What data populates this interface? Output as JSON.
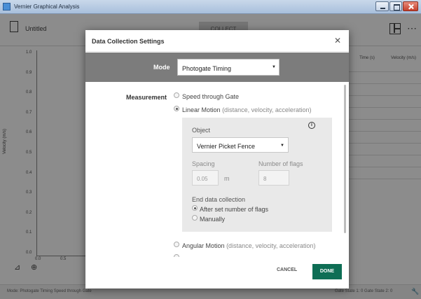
{
  "window": {
    "title": "Vernier Graphical Analysis"
  },
  "header": {
    "doc_title": "Untitled",
    "collect_label": "COLLECT"
  },
  "graph": {
    "y_axis_label": "Velocity (m/s)",
    "y_ticks": [
      "1.0",
      "0.9",
      "0.8",
      "0.7",
      "0.6",
      "0.5",
      "0.4",
      "0.3",
      "0.2",
      "0.1",
      "0.0"
    ],
    "x_ticks": [
      "0.0",
      "0.5"
    ]
  },
  "table": {
    "columns": [
      {
        "label": "Time (s)"
      },
      {
        "label": "Velocity (m/s)"
      }
    ]
  },
  "status": {
    "left": "Mode: Photogate Timing   Speed through Gate",
    "right": "Gate State 1: 0     Gate State 2: 0"
  },
  "dialog": {
    "title": "Data Collection Settings",
    "mode_label": "Mode",
    "mode_value": "Photogate Timing",
    "measurement_label": "Measurement",
    "options": [
      {
        "label": "Speed through Gate",
        "sub": "",
        "selected": false
      },
      {
        "label": "Linear Motion",
        "sub": "(distance, velocity, acceleration)",
        "selected": true
      },
      {
        "label": "Angular Motion",
        "sub": "(distance, velocity, acceleration)",
        "selected": false
      }
    ],
    "object_panel": {
      "object_label": "Object",
      "object_value": "Vernier Picket Fence",
      "spacing_label": "Spacing",
      "spacing_value": "0.05",
      "spacing_unit": "m",
      "flags_label": "Number of flags",
      "flags_value": "8",
      "end_label": "End data collection",
      "end_options": [
        {
          "label": "After set number of flags",
          "selected": true
        },
        {
          "label": "Manually",
          "selected": false
        }
      ]
    },
    "cancel_label": "CANCEL",
    "done_label": "DONE"
  },
  "colors": {
    "accent": "#0e6e55",
    "mode_band": "#7c7c7c",
    "overlay": "#000000"
  }
}
